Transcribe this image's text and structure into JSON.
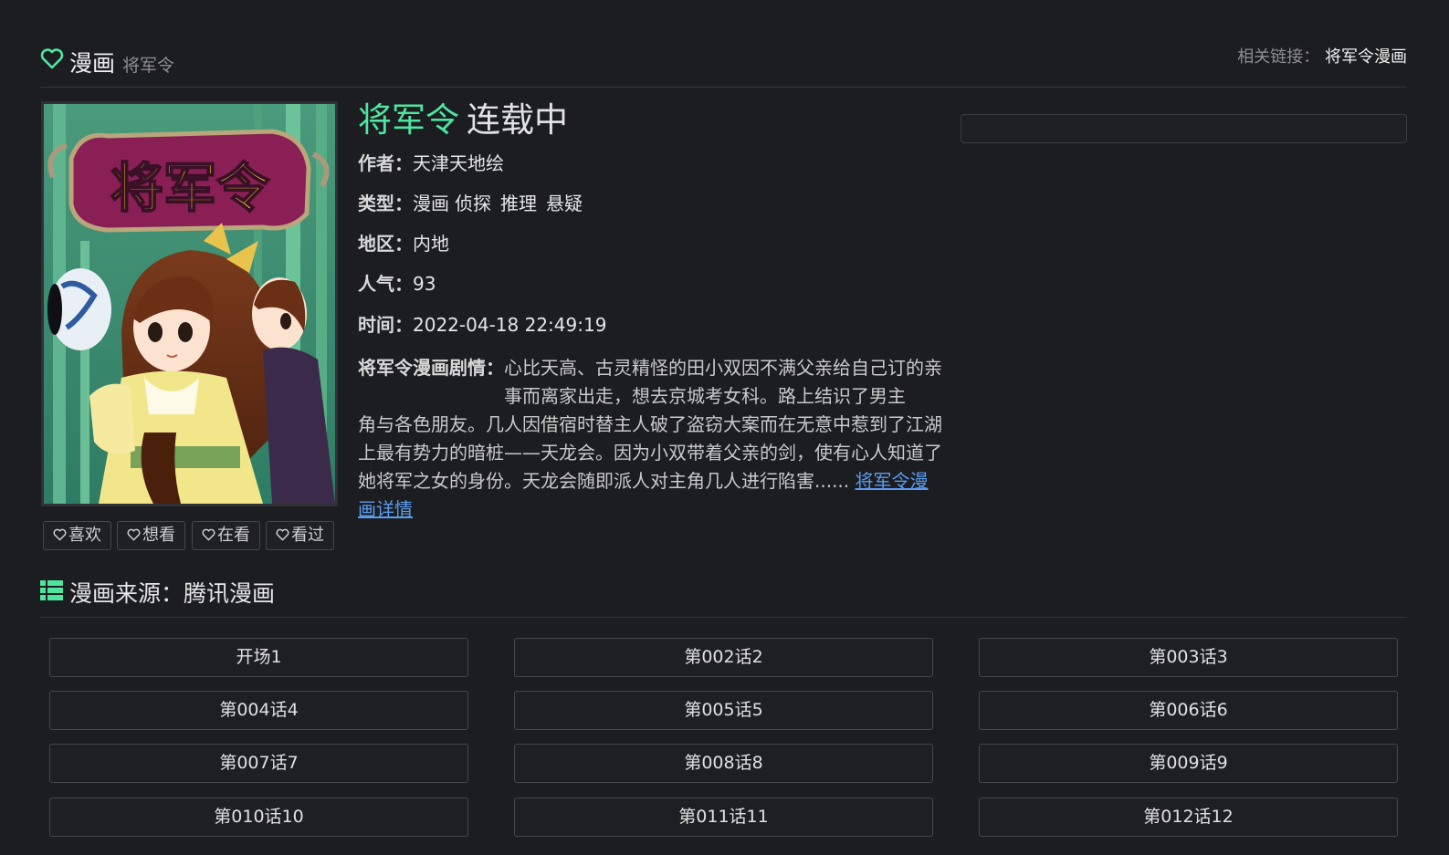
{
  "header": {
    "category": "漫画",
    "subtitle": "将军令",
    "related_label": "相关链接：",
    "related_link": "将军令漫画"
  },
  "colors": {
    "accent": "#4ee5a0",
    "link": "#5b9cf0",
    "background": "#1c1d20"
  },
  "cover": {
    "title_art": "将军令"
  },
  "actions": [
    {
      "label": "喜欢",
      "icon": "heart-icon"
    },
    {
      "label": "想看",
      "icon": "heart-icon"
    },
    {
      "label": "在看",
      "icon": "heart-icon"
    },
    {
      "label": "看过",
      "icon": "heart-icon"
    }
  ],
  "info": {
    "name": "将军令",
    "status": "连载中",
    "author_label": "作者：",
    "author": "天津天地绘",
    "type_label": "类型：",
    "types": [
      "漫画",
      "侦探",
      "推理",
      "悬疑"
    ],
    "region_label": "地区：",
    "region": "内地",
    "popularity_label": "人气：",
    "popularity": "93",
    "time_label": "时间：",
    "time": "2022-04-18 22:49:19",
    "desc_label": "将军令漫画剧情：",
    "desc_first": "心比天高、古灵精怪的田小双因不满父亲给自己订的亲事而离家出走，想去京城考女科。路上结识了男主",
    "desc_rest": "角与各色朋友。几人因借宿时替主人破了盗窃大案而在无意中惹到了江湖上最有势力的暗桩——天龙会。因为小双带着父亲的剑，使有心人知道了她将军之女的身份。天龙会随即派人对主角几人进行陷害......",
    "desc_link": "将军令漫画详情"
  },
  "source": {
    "label": "漫画来源：腾讯漫画"
  },
  "chapters": [
    "开场1",
    "第002话2",
    "第003话3",
    "第004话4",
    "第005话5",
    "第006话6",
    "第007话7",
    "第008话8",
    "第009话9",
    "第010话10",
    "第011话11",
    "第012话12"
  ]
}
